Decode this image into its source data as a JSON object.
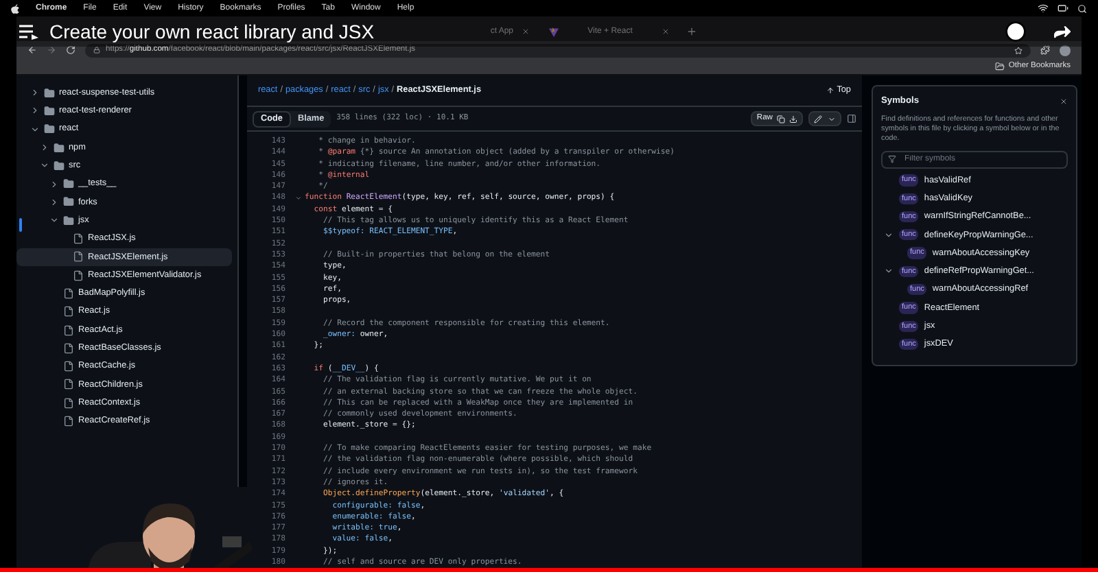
{
  "menu_bar": {
    "items": [
      "Chrome",
      "File",
      "Edit",
      "View",
      "History",
      "Bookmarks",
      "Profiles",
      "Tab",
      "Window",
      "Help"
    ]
  },
  "video_overlay": {
    "title": "Create your own react library and JSX",
    "progress": {
      "level": 1
    }
  },
  "tabs": [
    {
      "label": "ct App",
      "selected": false
    },
    {
      "label": "Vite + React",
      "selected": false
    }
  ],
  "address_bar": {
    "scheme": "https://",
    "host": "github.com",
    "path": "/facebook/react/blob/main/packages/react/src/jsx/ReactJSXElement.js"
  },
  "bookmarks_bar": {
    "items": [
      "Other Bookmarks"
    ]
  },
  "file_tree": [
    {
      "label": "react-suspense-test-utils",
      "kind": "folder",
      "expanded": false,
      "selected": false
    },
    {
      "label": "react-test-renderer",
      "kind": "folder",
      "expanded": false,
      "selected": false
    },
    {
      "label": "react",
      "kind": "folder",
      "expanded": true,
      "selected": false,
      "children": [
        {
          "label": "npm",
          "kind": "folder",
          "expanded": false,
          "selected": false
        },
        {
          "label": "src",
          "kind": "folder",
          "expanded": true,
          "selected": false,
          "children": [
            {
              "label": "__tests__",
              "kind": "folder",
              "expanded": false,
              "selected": false
            },
            {
              "label": "forks",
              "kind": "folder",
              "expanded": false,
              "selected": false
            },
            {
              "label": "jsx",
              "kind": "folder",
              "expanded": true,
              "selected": false,
              "children": [
                {
                  "label": "ReactJSX.js",
                  "kind": "file",
                  "selected": false
                },
                {
                  "label": "ReactJSXElement.js",
                  "kind": "file",
                  "selected": true
                },
                {
                  "label": "ReactJSXElementValidator.js",
                  "kind": "file",
                  "selected": false
                }
              ]
            },
            {
              "label": "BadMapPolyfill.js",
              "kind": "file",
              "selected": false
            },
            {
              "label": "React.js",
              "kind": "file",
              "selected": false
            },
            {
              "label": "ReactAct.js",
              "kind": "file",
              "selected": false
            },
            {
              "label": "ReactBaseClasses.js",
              "kind": "file",
              "selected": false
            },
            {
              "label": "ReactCache.js",
              "kind": "file",
              "selected": false
            },
            {
              "label": "ReactChildren.js",
              "kind": "file",
              "selected": false
            },
            {
              "label": "ReactContext.js",
              "kind": "file",
              "selected": false
            },
            {
              "label": "ReactCreateRef.js",
              "kind": "file",
              "selected": false
            }
          ]
        }
      ]
    }
  ],
  "breadcrumb": {
    "separator": "/",
    "links": [
      "react",
      "packages",
      "react",
      "src",
      "jsx"
    ],
    "current": "ReactJSXElement.js",
    "top_link": "Top"
  },
  "view_tabs": [
    {
      "label": "Code",
      "selected": true
    },
    {
      "label": "Blame",
      "selected": false
    }
  ],
  "file_info": "358 lines (322 loc) · 10.1 KB",
  "raw_button": "Raw",
  "code_lines": [
    {
      "num": "143",
      "kind": "comment",
      "text": "   * change in behavior."
    },
    {
      "num": "144",
      "tokens": [
        {
          "kind": "comment",
          "text": "   * "
        },
        {
          "kind": "tag",
          "text": "@param"
        },
        {
          "kind": "comment",
          "text": " {*} source An annotation object (added by a transpiler or otherwise)"
        }
      ]
    },
    {
      "num": "145",
      "kind": "comment",
      "text": "   * indicating filename, line number, and/or other information."
    },
    {
      "num": "146",
      "tokens": [
        {
          "kind": "comment",
          "text": "   * "
        },
        {
          "kind": "tag",
          "text": "@internal"
        }
      ]
    },
    {
      "num": "147",
      "kind": "comment",
      "text": "   */"
    },
    {
      "num": "148",
      "expanded": true,
      "tokens": [
        {
          "kind": "keyword",
          "text": "function "
        },
        {
          "kind": "function",
          "text": "ReactElement"
        },
        {
          "kind": "plain",
          "text": "(type, key, ref, self, source, owner, props) {"
        }
      ]
    },
    {
      "num": "149",
      "tokens": [
        {
          "kind": "keyword",
          "text": "  const "
        },
        {
          "kind": "plain",
          "text": "element = {"
        }
      ]
    },
    {
      "num": "150",
      "kind": "comment",
      "text": "    // This tag allows us to uniquely identify this as a React Element"
    },
    {
      "num": "151",
      "tokens": [
        {
          "kind": "constant",
          "text": "    $$typeof: REACT_ELEMENT_TYPE"
        },
        {
          "kind": "plain",
          "text": ","
        }
      ]
    },
    {
      "num": "152"
    },
    {
      "num": "153",
      "kind": "comment",
      "text": "    // Built-in properties that belong on the element"
    },
    {
      "num": "154",
      "kind": "plain",
      "text": "    type,"
    },
    {
      "num": "155",
      "kind": "plain",
      "text": "    key,"
    },
    {
      "num": "156",
      "kind": "plain",
      "text": "    ref,"
    },
    {
      "num": "157",
      "kind": "plain",
      "text": "    props,"
    },
    {
      "num": "158"
    },
    {
      "num": "159",
      "kind": "comment",
      "text": "    // Record the component responsible for creating this element."
    },
    {
      "num": "160",
      "tokens": [
        {
          "kind": "constant",
          "text": "    _owner:"
        },
        {
          "kind": "plain",
          "text": " owner,"
        }
      ]
    },
    {
      "num": "161",
      "kind": "plain",
      "text": "  };"
    },
    {
      "num": "162"
    },
    {
      "num": "163",
      "tokens": [
        {
          "kind": "keyword",
          "text": "  if "
        },
        {
          "kind": "plain",
          "text": "("
        },
        {
          "kind": "constant",
          "text": "__DEV__"
        },
        {
          "kind": "plain",
          "text": ") {"
        }
      ]
    },
    {
      "num": "164",
      "kind": "comment",
      "text": "    // The validation flag is currently mutative. We put it on"
    },
    {
      "num": "165",
      "kind": "comment",
      "text": "    // an external backing store so that we can freeze the whole object."
    },
    {
      "num": "166",
      "kind": "comment",
      "text": "    // This can be replaced with a WeakMap once they are implemented in"
    },
    {
      "num": "167",
      "kind": "comment",
      "text": "    // commonly used development environments."
    },
    {
      "num": "168",
      "kind": "plain",
      "text": "    element._store = {};"
    },
    {
      "num": "169"
    },
    {
      "num": "170",
      "kind": "comment",
      "text": "    // To make comparing ReactElements easier for testing purposes, we make"
    },
    {
      "num": "171",
      "kind": "comment",
      "text": "    // the validation flag non-enumerable (where possible, which should"
    },
    {
      "num": "172",
      "kind": "comment",
      "text": "    // include every environment we run tests in), so the test framework"
    },
    {
      "num": "173",
      "kind": "comment",
      "text": "    // ignores it."
    },
    {
      "num": "174",
      "tokens": [
        {
          "kind": "object",
          "text": "    Object.defineProperty"
        },
        {
          "kind": "plain",
          "text": "(element._store, "
        },
        {
          "kind": "string",
          "text": "'validated'"
        },
        {
          "kind": "plain",
          "text": ", {"
        }
      ]
    },
    {
      "num": "175",
      "tokens": [
        {
          "kind": "constant",
          "text": "      configurable: false"
        },
        {
          "kind": "plain",
          "text": ","
        }
      ]
    },
    {
      "num": "176",
      "tokens": [
        {
          "kind": "constant",
          "text": "      enumerable: false"
        },
        {
          "kind": "plain",
          "text": ","
        }
      ]
    },
    {
      "num": "177",
      "tokens": [
        {
          "kind": "constant",
          "text": "      writable: true"
        },
        {
          "kind": "plain",
          "text": ","
        }
      ]
    },
    {
      "num": "178",
      "tokens": [
        {
          "kind": "constant",
          "text": "      value: false"
        },
        {
          "kind": "plain",
          "text": ","
        }
      ]
    },
    {
      "num": "179",
      "kind": "plain",
      "text": "    });"
    },
    {
      "num": "180",
      "kind": "comment",
      "text": "    // self and source are DEV only properties."
    }
  ],
  "symbols": {
    "title": "Symbols",
    "description": "Find definitions and references for functions and other symbols in this file by clicking a symbol below or in the code.",
    "filter": {
      "placeholder": "Filter symbols"
    },
    "items": [
      {
        "badge": "func",
        "name": "hasValidRef"
      },
      {
        "badge": "func",
        "name": "hasValidKey"
      },
      {
        "badge": "func",
        "name": "warnIfStringRefCannotBe..."
      },
      {
        "badge": "func",
        "name": "defineKeyPropWarningGe...",
        "expanded": true,
        "children": [
          {
            "badge": "func",
            "name": "warnAboutAccessingKey"
          }
        ]
      },
      {
        "badge": "func",
        "name": "defineRefPropWarningGet...",
        "expanded": true,
        "children": [
          {
            "badge": "func",
            "name": "warnAboutAccessingRef"
          }
        ]
      },
      {
        "badge": "func",
        "name": "ReactElement"
      },
      {
        "badge": "func",
        "name": "jsx"
      },
      {
        "badge": "func",
        "name": "jsxDEV"
      }
    ]
  }
}
